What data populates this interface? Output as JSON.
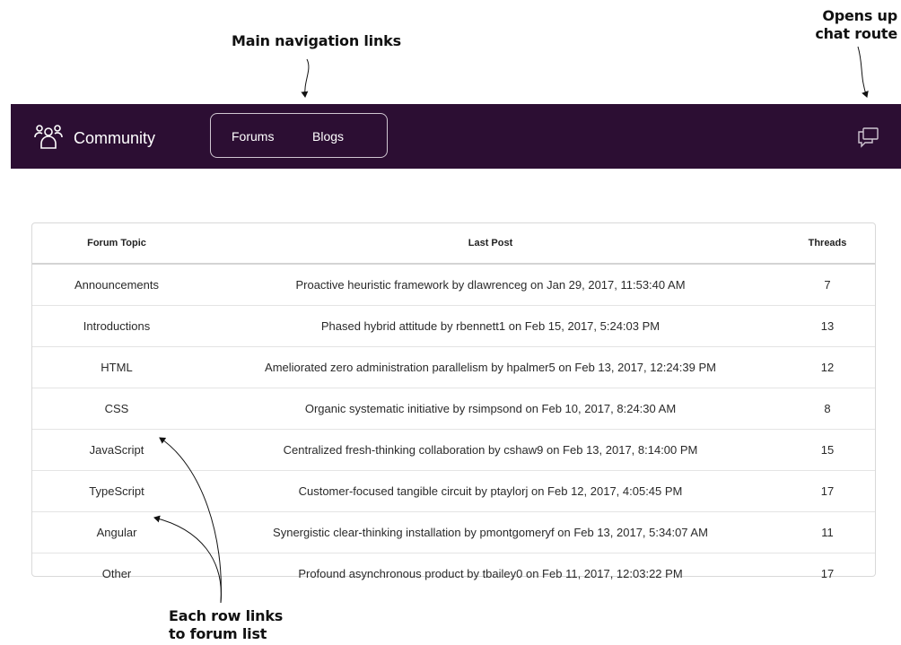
{
  "annotations": {
    "nav_links": "Main navigation links",
    "chat_route": [
      "Opens up",
      "chat route"
    ],
    "rows": [
      "Each row links",
      "to forum list"
    ]
  },
  "app": {
    "brand": "Community",
    "brand_icon": "users-group-icon",
    "colors": {
      "navbar_bg": "#2c0e33",
      "nav_text": "#ffffff"
    }
  },
  "nav": {
    "forums": "Forums",
    "blogs": "Blogs",
    "chat_icon": "chat-bubbles-icon"
  },
  "table": {
    "headers": {
      "topic": "Forum Topic",
      "last_post": "Last Post",
      "threads": "Threads"
    },
    "rows": [
      {
        "topic": "Announcements",
        "last_post": "Proactive heuristic framework by dlawrenceg on Jan 29, 2017, 11:53:40 AM",
        "threads": "7"
      },
      {
        "topic": "Introductions",
        "last_post": "Phased hybrid attitude by rbennett1 on Feb 15, 2017, 5:24:03 PM",
        "threads": "13"
      },
      {
        "topic": "HTML",
        "last_post": "Ameliorated zero administration parallelism by hpalmer5 on Feb 13, 2017, 12:24:39 PM",
        "threads": "12"
      },
      {
        "topic": "CSS",
        "last_post": "Organic systematic initiative by rsimpsond on Feb 10, 2017, 8:24:30 AM",
        "threads": "8"
      },
      {
        "topic": "JavaScript",
        "last_post": "Centralized fresh-thinking collaboration by cshaw9 on Feb 13, 2017, 8:14:00 PM",
        "threads": "15"
      },
      {
        "topic": "TypeScript",
        "last_post": "Customer-focused tangible circuit by ptaylorj on Feb 12, 2017, 4:05:45 PM",
        "threads": "17"
      },
      {
        "topic": "Angular",
        "last_post": "Synergistic clear-thinking installation by pmontgomeryf on Feb 13, 2017, 5:34:07 AM",
        "threads": "11"
      },
      {
        "topic": "Other",
        "last_post": "Profound asynchronous product by tbailey0 on Feb 11, 2017, 12:03:22 PM",
        "threads": "17"
      }
    ]
  }
}
